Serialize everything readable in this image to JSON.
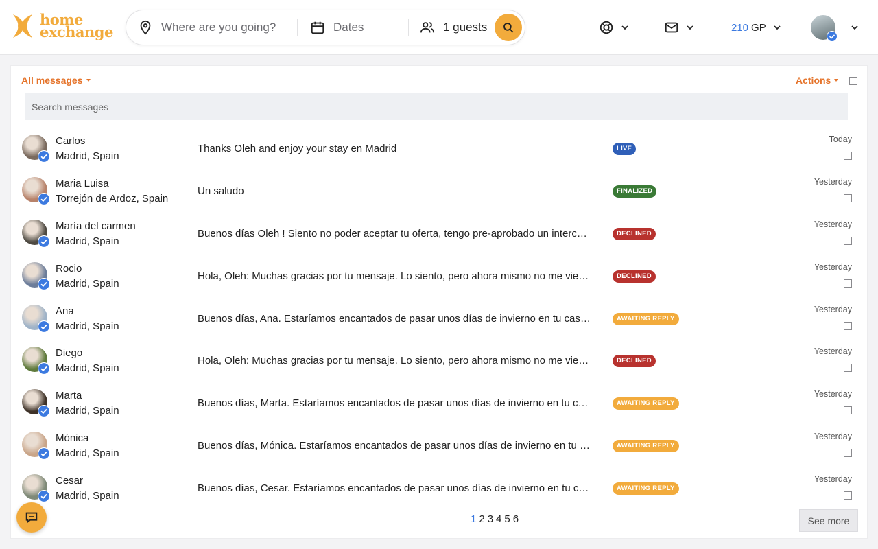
{
  "header": {
    "logo_line1": "home",
    "logo_line2": "exchange",
    "search": {
      "where_placeholder": "Where are you going?",
      "dates_label": "Dates",
      "guests_label": "1 guests"
    },
    "gp_value": "210",
    "gp_unit": "GP"
  },
  "inbox": {
    "filter_label": "All messages",
    "actions_label": "Actions",
    "search_placeholder": "Search messages",
    "pages": [
      "1",
      "2",
      "3",
      "4",
      "5",
      "6"
    ],
    "active_page": "1",
    "see_more_label": "See more"
  },
  "status_colors": {
    "LIVE": "#2f5fb8",
    "FINALIZED": "#3a7a36",
    "DECLINED": "#b8322e",
    "AWAITING REPLY": "#f2ab3c"
  },
  "conversations": [
    {
      "name": "Carlos",
      "location": "Madrid, Spain",
      "message": "Thanks Oleh and enjoy your stay en Madrid",
      "status": "LIVE",
      "date": "Today",
      "avatar_color": "#7a6a5e"
    },
    {
      "name": "Maria Luisa",
      "location": "Torrejón de Ardoz, Spain",
      "message": "Un saludo",
      "status": "FINALIZED",
      "date": "Yesterday",
      "avatar_color": "#b7826a"
    },
    {
      "name": "María del carmen",
      "location": "Madrid, Spain",
      "message": "Buenos días Oleh ! Siento no poder aceptar tu oferta, tengo pre-aprobado un intercambio con otra familia para esas fechas.",
      "status": "DECLINED",
      "date": "Yesterday",
      "avatar_color": "#4e4a42"
    },
    {
      "name": "Rocio",
      "location": "Madrid, Spain",
      "message": "Hola, Oleh: Muchas gracias por tu mensaje. Lo siento, pero ahora mismo no me viene bien hacer el intercambio.",
      "status": "DECLINED",
      "date": "Yesterday",
      "avatar_color": "#6c7d9a"
    },
    {
      "name": "Ana",
      "location": "Madrid, Spain",
      "message": "Buenos días, Ana. Estaríamos encantados de pasar unos días de invierno en tu casa de Madrid.",
      "status": "AWAITING REPLY",
      "date": "Yesterday",
      "avatar_color": "#9fb3c8"
    },
    {
      "name": "Diego",
      "location": "Madrid, Spain",
      "message": "Hola, Oleh: Muchas gracias por tu mensaje. Lo siento, pero ahora mismo no me viene bien hacer el intercambio.",
      "status": "DECLINED",
      "date": "Yesterday",
      "avatar_color": "#5f7a3c"
    },
    {
      "name": "Marta",
      "location": "Madrid, Spain",
      "message": "Buenos días, Marta. Estaríamos encantados de pasar unos días de invierno en tu casa de Madrid.",
      "status": "AWAITING REPLY",
      "date": "Yesterday",
      "avatar_color": "#3e3228"
    },
    {
      "name": "Mónica",
      "location": "Madrid, Spain",
      "message": "Buenos días, Mónica. Estaríamos encantados de pasar unos días de invierno en tu casa de Madrid.",
      "status": "AWAITING REPLY",
      "date": "Yesterday",
      "avatar_color": "#c9a589"
    },
    {
      "name": "Cesar",
      "location": "Madrid, Spain",
      "message": "Buenos días, Cesar. Estaríamos encantados de pasar unos días de invierno en tu casa de Madrid.",
      "status": "AWAITING REPLY",
      "date": "Yesterday",
      "avatar_color": "#7f8a78"
    }
  ]
}
